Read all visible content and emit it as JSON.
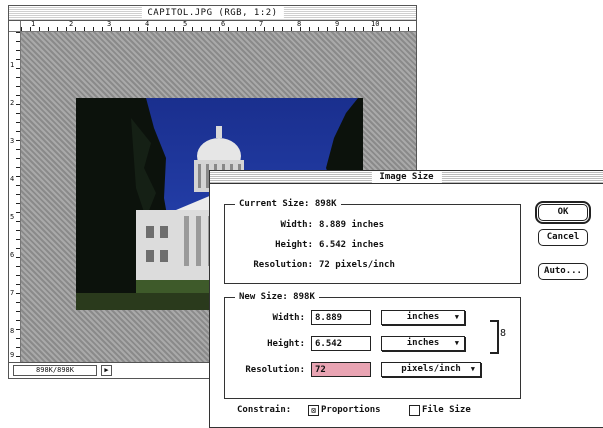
{
  "document": {
    "title": "CAPITOL.JPG (RGB, 1:2)",
    "status": "898K/898K",
    "status_arrow": "▶",
    "ruler_h": [
      "1",
      "2",
      "3",
      "4",
      "5",
      "6",
      "7",
      "8",
      "9",
      "10"
    ],
    "ruler_v": [
      "1",
      "2",
      "3",
      "4",
      "5",
      "6",
      "7",
      "8",
      "9"
    ]
  },
  "dialog": {
    "title": "Image Size",
    "current": {
      "legend": "Current Size: 898K",
      "width_label": "Width:",
      "width_value": "8.889 inches",
      "height_label": "Height:",
      "height_value": "6.542 inches",
      "res_label": "Resolution:",
      "res_value": "72 pixels/inch"
    },
    "new": {
      "legend": "New Size: 898K",
      "width_label": "Width:",
      "width_value": "8.889",
      "width_unit": "inches",
      "height_label": "Height:",
      "height_value": "6.542",
      "height_unit": "inches",
      "res_label": "Resolution:",
      "res_value": "72",
      "res_unit": "pixels/inch",
      "popup_arrow": "▼",
      "link_glyph": "8"
    },
    "constrain": {
      "label": "Constrain:",
      "proportions_label": "Proportions",
      "proportions_checked": true,
      "file_size_label": "File Size",
      "file_size_checked": false,
      "checkmark": "⊠"
    },
    "buttons": {
      "ok": "OK",
      "cancel": "Cancel",
      "auto": "Auto..."
    }
  },
  "colors": {
    "highlight_field": "#e9a4b3",
    "sky": "#233ea8"
  }
}
